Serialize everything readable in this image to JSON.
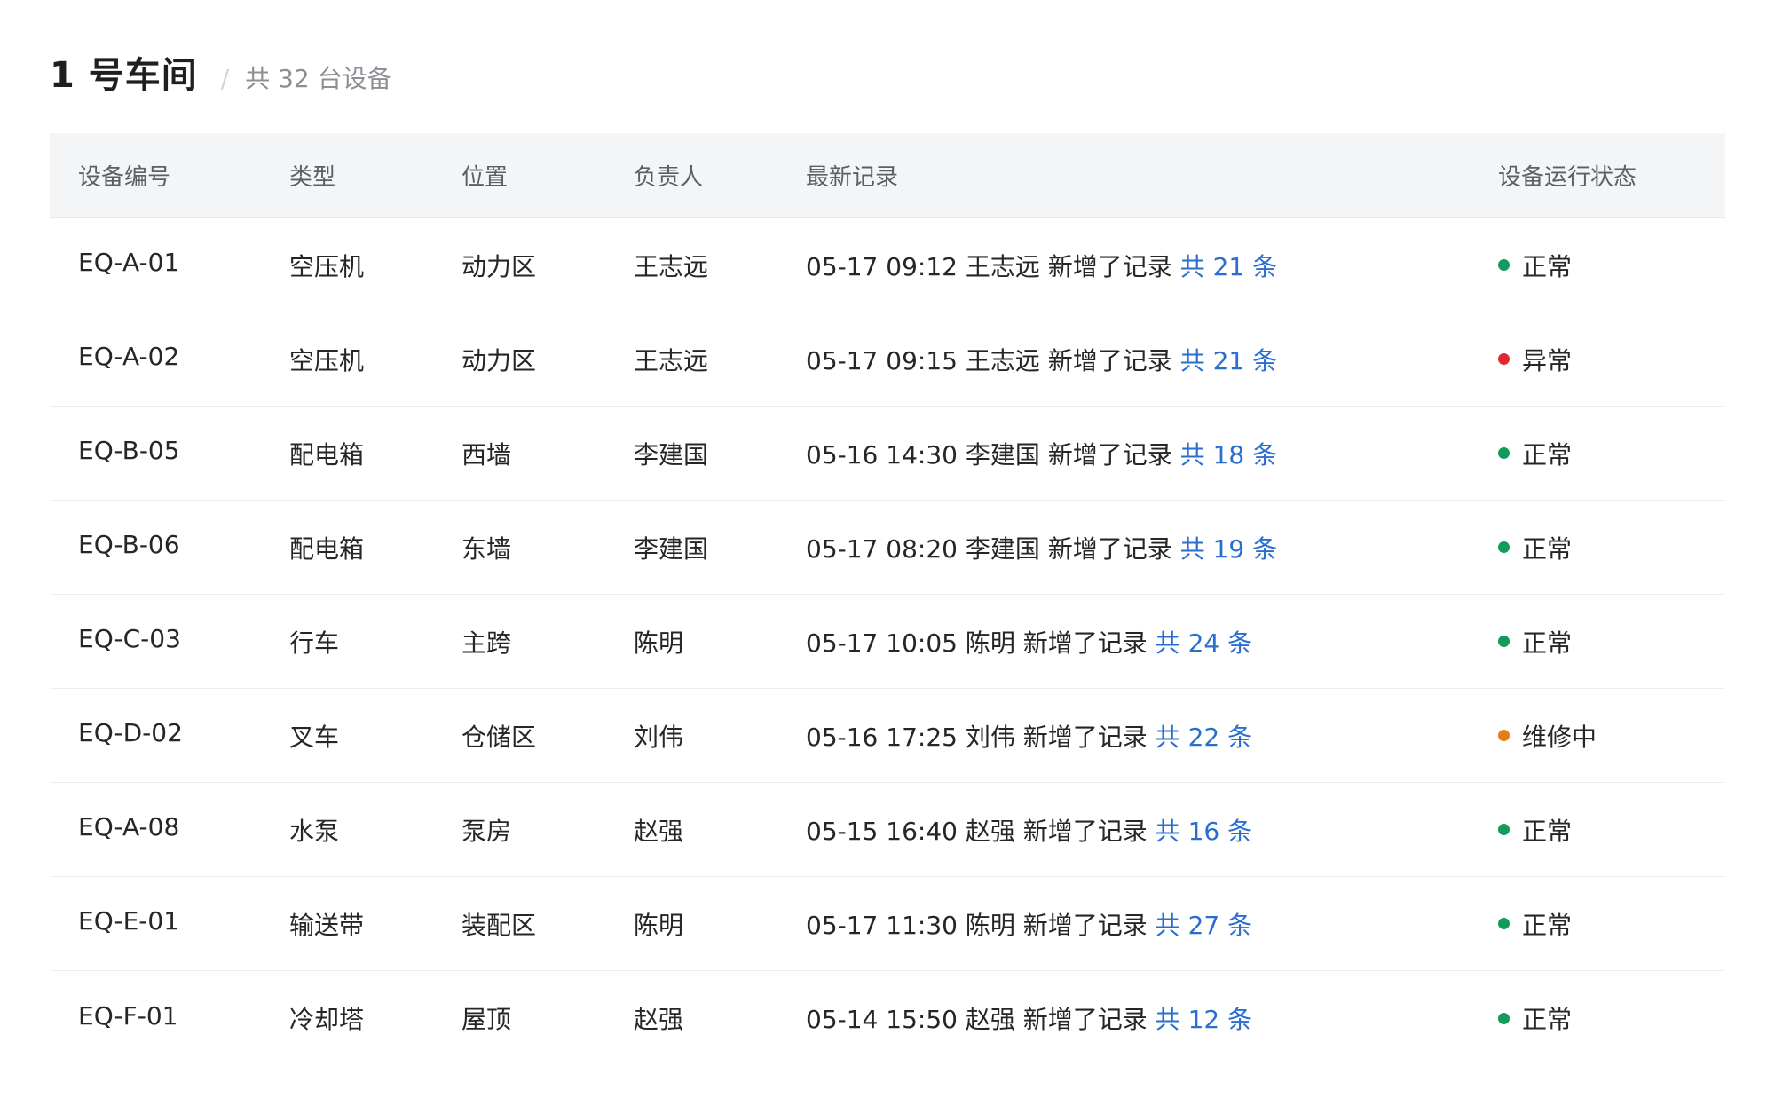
{
  "header": {
    "title": "1 号车间",
    "separator": "/",
    "subtitle": "共 32 台设备"
  },
  "colors": {
    "normal": "#149a5a",
    "abnormal": "#e0282e",
    "maintenance": "#e47d15",
    "link": "#2a6fd0"
  },
  "table": {
    "columns": [
      "设备编号",
      "类型",
      "位置",
      "负责人",
      "最新记录",
      "设备运行状态"
    ],
    "rows": [
      {
        "id": "EQ-A-01",
        "type": "空压机",
        "location": "动力区",
        "owner": "王志远",
        "record": "05-17 09:12 王志远 新增了记录",
        "count": "共 21 条",
        "status": "正常",
        "status_color": "#149a5a"
      },
      {
        "id": "EQ-A-02",
        "type": "空压机",
        "location": "动力区",
        "owner": "王志远",
        "record": "05-17 09:15 王志远 新增了记录",
        "count": "共 21 条",
        "status": "异常",
        "status_color": "#e0282e"
      },
      {
        "id": "EQ-B-05",
        "type": "配电箱",
        "location": "西墙",
        "owner": "李建国",
        "record": "05-16 14:30 李建国 新增了记录",
        "count": "共 18 条",
        "status": "正常",
        "status_color": "#149a5a"
      },
      {
        "id": "EQ-B-06",
        "type": "配电箱",
        "location": "东墙",
        "owner": "李建国",
        "record": "05-17 08:20 李建国 新增了记录",
        "count": "共 19 条",
        "status": "正常",
        "status_color": "#149a5a"
      },
      {
        "id": "EQ-C-03",
        "type": "行车",
        "location": "主跨",
        "owner": "陈明",
        "record": "05-17 10:05 陈明 新增了记录",
        "count": "共 24 条",
        "status": "正常",
        "status_color": "#149a5a"
      },
      {
        "id": "EQ-D-02",
        "type": "叉车",
        "location": "仓储区",
        "owner": "刘伟",
        "record": "05-16 17:25 刘伟 新增了记录",
        "count": "共 22 条",
        "status": "维修中",
        "status_color": "#e47d15"
      },
      {
        "id": "EQ-A-08",
        "type": "水泵",
        "location": "泵房",
        "owner": "赵强",
        "record": "05-15 16:40 赵强 新增了记录",
        "count": "共 16 条",
        "status": "正常",
        "status_color": "#149a5a"
      },
      {
        "id": "EQ-E-01",
        "type": "输送带",
        "location": "装配区",
        "owner": "陈明",
        "record": "05-17 11:30 陈明 新增了记录",
        "count": "共 27 条",
        "status": "正常",
        "status_color": "#149a5a"
      },
      {
        "id": "EQ-F-01",
        "type": "冷却塔",
        "location": "屋顶",
        "owner": "赵强",
        "record": "05-14 15:50 赵强 新增了记录",
        "count": "共 12 条",
        "status": "正常",
        "status_color": "#149a5a"
      }
    ]
  }
}
